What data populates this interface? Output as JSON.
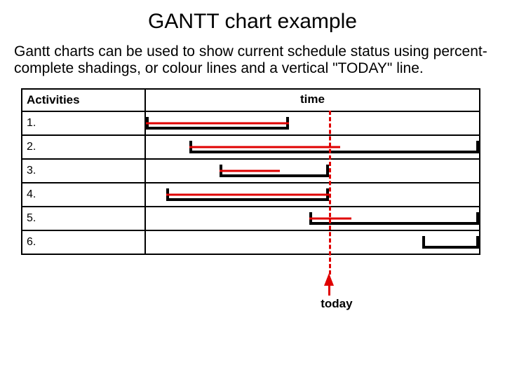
{
  "title": "GANTT chart example",
  "description": "Gantt charts can be used to show current schedule status using percent-complete shadings, or colour lines and a vertical \"TODAY\" line.",
  "headers": {
    "activities": "Activities",
    "time": "time"
  },
  "today_label": "today",
  "chart_data": {
    "type": "bar",
    "xlabel": "time",
    "ylabel": "Activities",
    "today": 55,
    "series": [
      {
        "name": "1.",
        "start": 0,
        "end": 43,
        "progress": 100
      },
      {
        "name": "2.",
        "start": 13,
        "end": 100,
        "progress": 52
      },
      {
        "name": "3.",
        "start": 22,
        "end": 55,
        "progress": 55
      },
      {
        "name": "4.",
        "start": 6,
        "end": 55,
        "progress": 100
      },
      {
        "name": "5.",
        "start": 49,
        "end": 100,
        "progress": 25
      },
      {
        "name": "6.",
        "start": 83,
        "end": 100,
        "progress": 0
      }
    ]
  }
}
